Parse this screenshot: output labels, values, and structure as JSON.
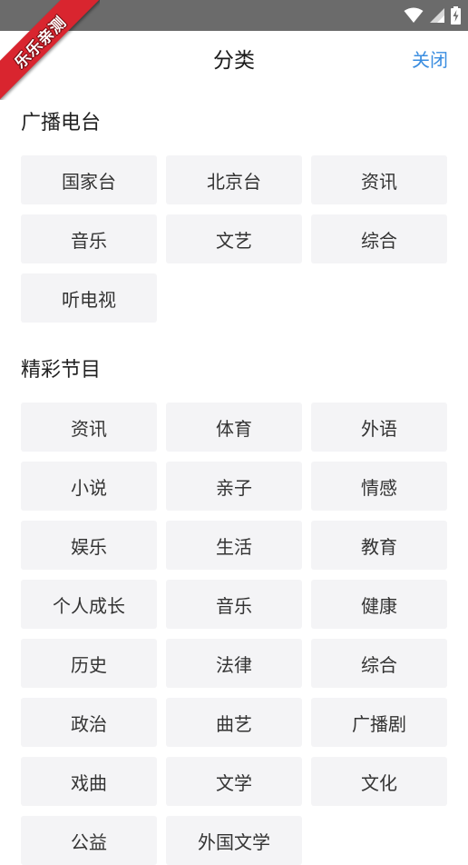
{
  "status_bar": {
    "icons": [
      "wifi-icon",
      "signal-icon",
      "battery-charging-icon"
    ]
  },
  "ribbon": {
    "text": "乐乐亲测"
  },
  "header": {
    "title": "分类",
    "close_label": "关闭"
  },
  "colors": {
    "accent": "#3a8de0",
    "chip_bg": "#f4f4f6",
    "status_bar": "#6b6b6b",
    "ribbon": "#d9252f"
  },
  "sections": [
    {
      "title": "广播电台",
      "items": [
        "国家台",
        "北京台",
        "资讯",
        "音乐",
        "文艺",
        "综合",
        "听电视"
      ]
    },
    {
      "title": "精彩节目",
      "items": [
        "资讯",
        "体育",
        "外语",
        "小说",
        "亲子",
        "情感",
        "娱乐",
        "生活",
        "教育",
        "个人成长",
        "音乐",
        "健康",
        "历史",
        "法律",
        "综合",
        "政治",
        "曲艺",
        "广播剧",
        "戏曲",
        "文学",
        "文化",
        "公益",
        "外国文学"
      ]
    }
  ]
}
